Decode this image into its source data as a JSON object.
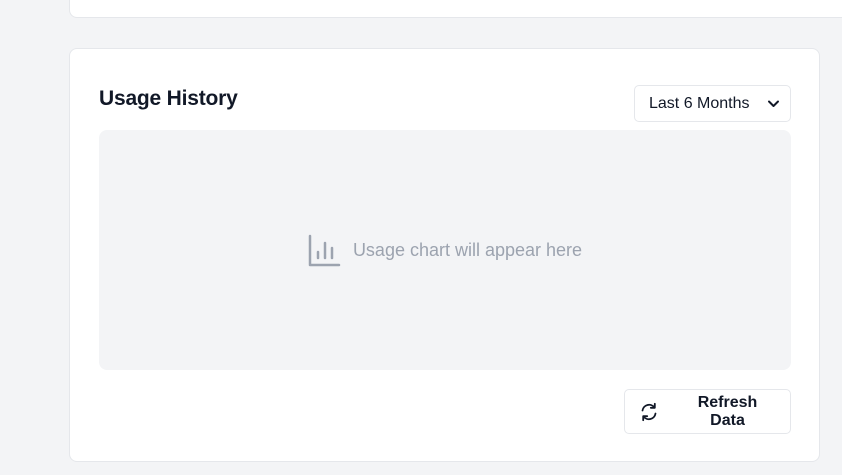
{
  "usage_history": {
    "title": "Usage History",
    "range_select": {
      "selected": "Last 6 Months",
      "icon": "chevron-down-icon"
    },
    "chart_placeholder": {
      "icon": "bar-chart-icon",
      "text": "Usage chart will appear here"
    },
    "refresh_button": {
      "label": "Refresh Data",
      "icon": "refresh-icon"
    }
  },
  "colors": {
    "page_background": "#f3f4f6",
    "card_background": "#ffffff",
    "border": "#e5e7eb",
    "muted_text": "#9ca3af",
    "text": "#111827"
  }
}
